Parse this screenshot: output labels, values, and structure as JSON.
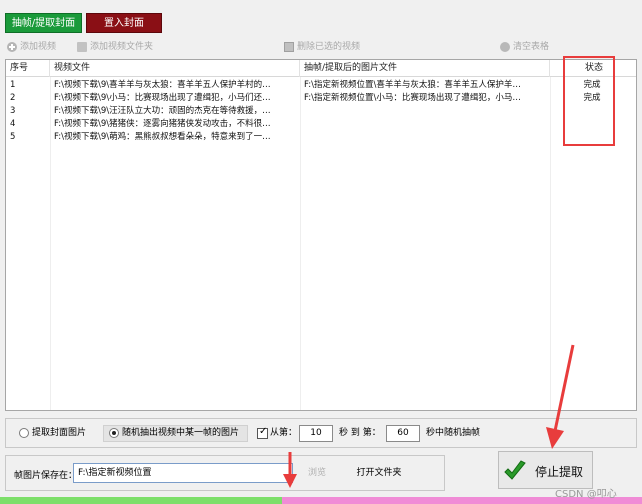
{
  "tabs": {
    "extract_cover": "抽帧/提取封面",
    "insert_cover": "置入封面"
  },
  "toolbar": {
    "add_video": "添加视频",
    "add_folder": "添加视频文件夹",
    "delete_selected": "删除已选的视频",
    "clear_table": "清空表格"
  },
  "table": {
    "headers": {
      "index": "序号",
      "video_file": "视频文件",
      "image_file": "抽帧/提取后的图片文件",
      "status": "状态"
    },
    "rows": [
      {
        "index": "1",
        "video": "F:\\视频下载\\9\\喜羊羊与灰太狼：喜羊羊五人保护羊村的…",
        "image": "F:\\指定新视频位置\\喜羊羊与灰太狼：喜羊羊五人保护羊…",
        "status": "完成"
      },
      {
        "index": "2",
        "video": "F:\\视频下载\\9\\小马：比赛现场出现了遭缉犯，小马们还…",
        "image": "F:\\指定新视频位置\\小马：比赛现场出现了遭缉犯，小马…",
        "status": "完成"
      },
      {
        "index": "3",
        "video": "F:\\视频下载\\9\\汪汪队立大功：顽固的杰克在等待救援，…",
        "image": "",
        "status": ""
      },
      {
        "index": "4",
        "video": "F:\\视频下载\\9\\猪猪侠：逐雾向猪猪侠发动攻击，不料很…",
        "image": "",
        "status": ""
      },
      {
        "index": "5",
        "video": "F:\\视频下载\\9\\萌鸡：黑熊叔叔想看朵朵，特意来到了一…",
        "image": "",
        "status": ""
      }
    ]
  },
  "options": {
    "extract_cover_label": "提取封面图片",
    "random_frame_label": "随机抽出视频中某一帧的图片",
    "from_label": "从第：",
    "from_value": "10",
    "to_label": "秒 到 第：",
    "to_value": "60",
    "suffix_label": "秒中随机抽帧"
  },
  "save": {
    "label": "帧图片保存在：",
    "path": "F:\\指定新视频位置",
    "browse": "浏览",
    "open_folder": "打开文件夹"
  },
  "stop_button": "停止提取",
  "watermark": "CSDN @叩心",
  "colors": {
    "accent_green": "#1a9a3a",
    "accent_red": "#8a0f15",
    "highlight_red": "#e83c3c"
  }
}
